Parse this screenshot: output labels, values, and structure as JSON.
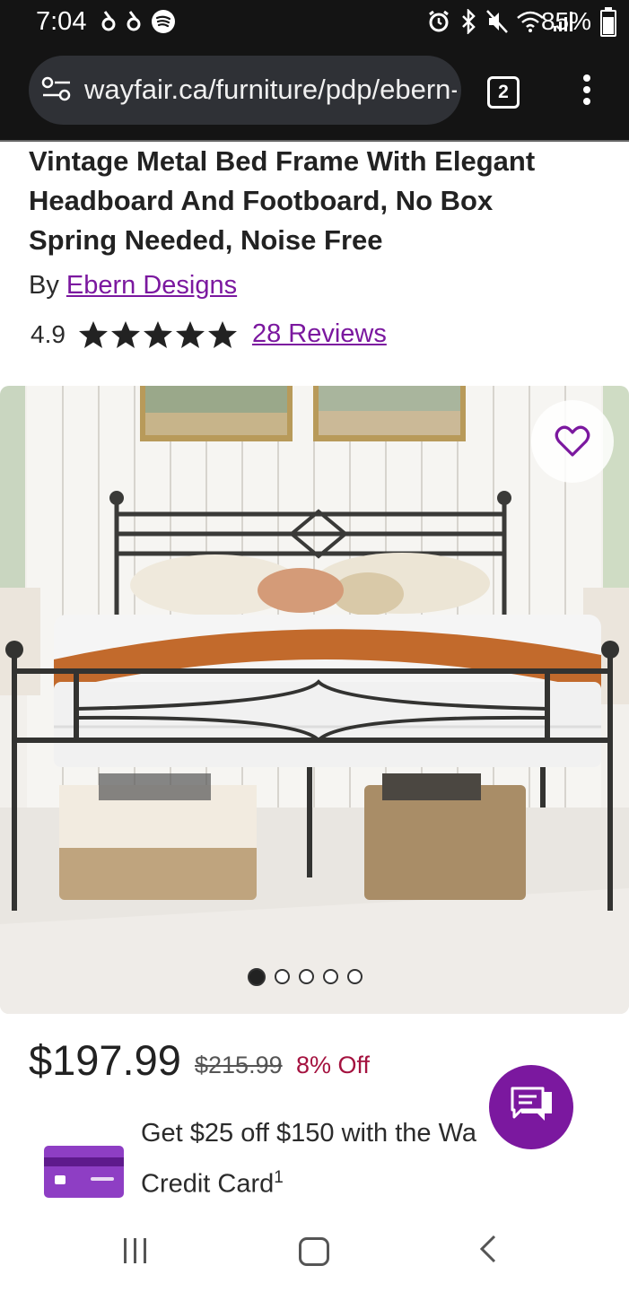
{
  "status_bar": {
    "time": "7:04",
    "battery": "85%",
    "battery_level": 0.85,
    "left_icons": [
      "notification-icon",
      "notification-icon",
      "spotify-icon"
    ],
    "right_icons": [
      "alarm-icon",
      "bluetooth-icon",
      "mute-icon",
      "wifi-icon",
      "signal-icon"
    ]
  },
  "browser": {
    "url": "wayfair.ca/furniture/pdp/ebern-designs",
    "tab_count": "2"
  },
  "product": {
    "title": "Vintage Metal Bed Frame With Elegant Headboard And Footboard, No Box Spring Needed, Noise Free",
    "by_label": "By",
    "brand": "Ebern Designs",
    "rating": "4.9",
    "stars": 5,
    "reviews": "28 Reviews",
    "image_count": 5,
    "image_index": 0
  },
  "pricing": {
    "price": "$197.99",
    "original_price": "$215.99",
    "discount": "8% Off"
  },
  "promo": {
    "line1": "Get $25 off $150 with the Wa",
    "line2": "Credit Card",
    "sup": "1"
  },
  "colors": {
    "accent": "#7b189f",
    "discount": "#a4123f",
    "topbar": "#141414"
  }
}
